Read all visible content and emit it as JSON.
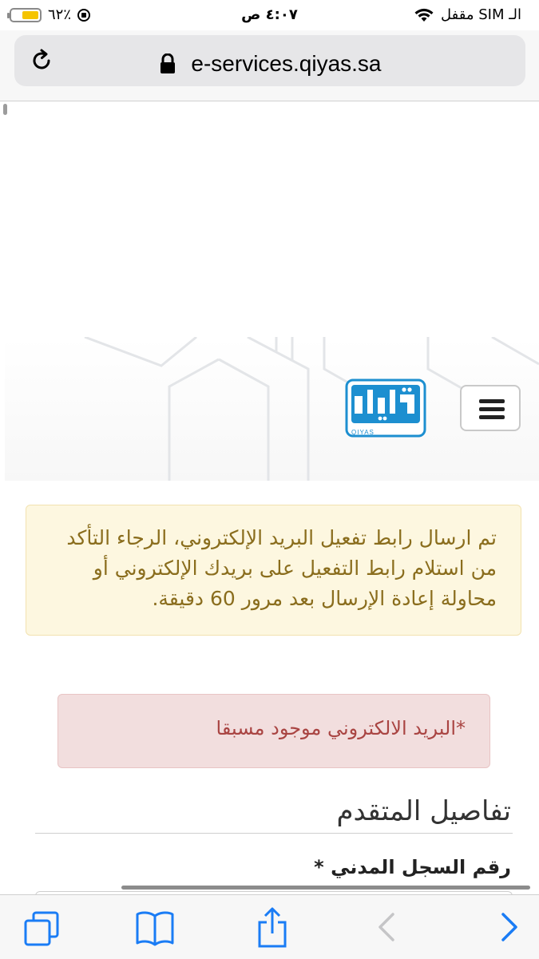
{
  "status_bar": {
    "carrier": "الـ SIM مقفل",
    "time": "٤:٠٧ ص",
    "battery_percent": "٦٢٪",
    "battery_level": 0.62,
    "battery_color": "#f5c400"
  },
  "browser": {
    "url": "e-services.qiyas.sa"
  },
  "header": {
    "logo_caption": "QIYAS",
    "brand_color": "#1d8fd0"
  },
  "alerts": {
    "warning_text": "تم ارسال رابط تفعيل البريد الإلكتروني، الرجاء التأكد من استلام رابط التفعيل على بريدك الإلكتروني أو محاولة إعادة الإرسال بعد مرور 60 دقيقة.",
    "error_text": "*البريد الالكتروني موجود مسبقا"
  },
  "form": {
    "section_title": "تفاصيل المتقدم",
    "civil_id_label": "رقم السجل المدني *"
  },
  "icons": {
    "reload": "reload-icon",
    "lock": "lock-icon",
    "menu": "hamburger-icon",
    "tabs": "tabs-icon",
    "bookmarks": "bookmarks-icon",
    "share": "share-icon",
    "back": "back-arrow-icon",
    "forward": "forward-arrow-icon"
  }
}
